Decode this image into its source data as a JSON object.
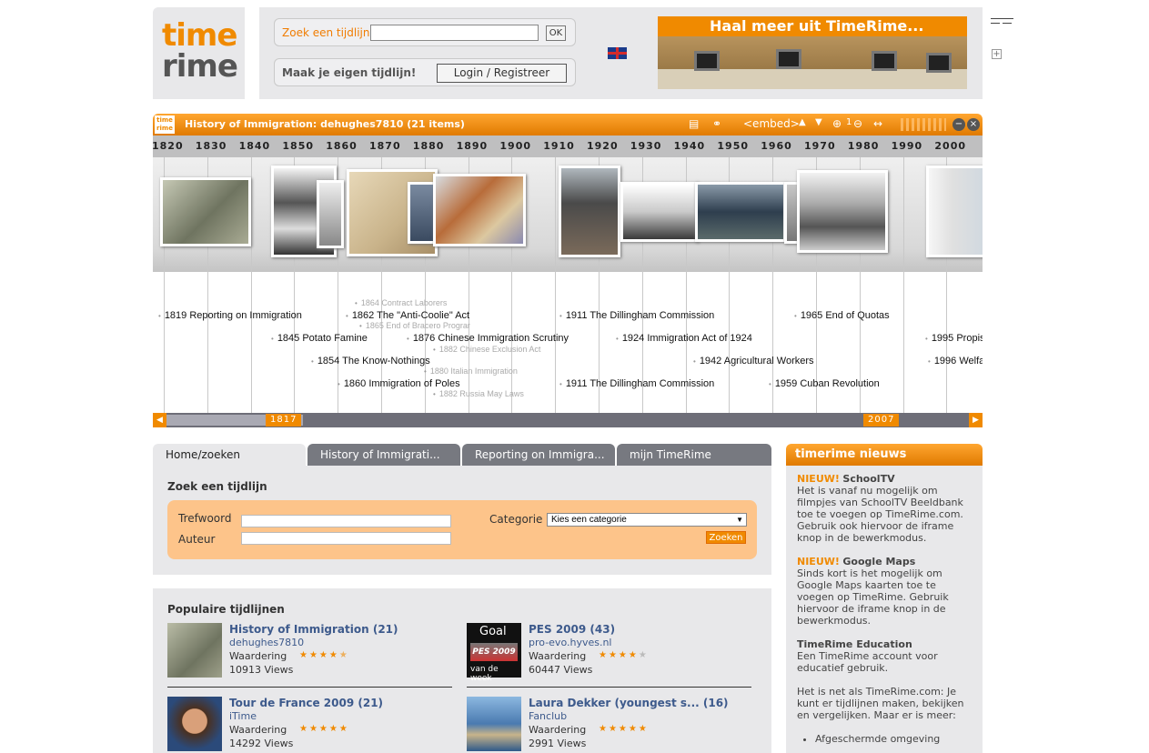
{
  "logo": {
    "line1": "time",
    "line2": "rime"
  },
  "header": {
    "search_label": "Zoek een tijdlijn",
    "search_value": "",
    "ok_label": "OK",
    "create_label": "Maak je eigen tijdlijn!",
    "login_label": "Login / Registreer",
    "banner_text": "Haal meer uit TimeRime..."
  },
  "timeline": {
    "logo_line1": "time",
    "logo_line2": "rime",
    "title": "History of Immigration: dehughes7810  (21 items)",
    "embed_label": "<embed>",
    "zoom_value": "1",
    "years": [
      "1820",
      "1830",
      "1840",
      "1850",
      "1860",
      "1870",
      "1880",
      "1890",
      "1900",
      "1910",
      "1920",
      "1930",
      "1940",
      "1950",
      "1960",
      "1970",
      "1980",
      "1990",
      "2000"
    ],
    "events": [
      {
        "label": "1864 Contract Laborers",
        "small": true
      },
      {
        "label": "1819 Reporting on Immigration",
        "small": false
      },
      {
        "label": "1862 The \"Anti-Coolie\" Act",
        "small": false
      },
      {
        "label": "1865 End of Bracero Prograr",
        "small": true
      },
      {
        "label": "1845 Potato Famine",
        "small": false
      },
      {
        "label": "1876 Chinese Immigration Scrutiny",
        "small": false
      },
      {
        "label": "1882 Chinese Exclusion Act",
        "small": true
      },
      {
        "label": "1854 The Know-Nothings",
        "small": false
      },
      {
        "label": "1880 Italian Immigration",
        "small": true
      },
      {
        "label": "1860 Immigration of Poles",
        "small": false
      },
      {
        "label": "1882 Russia May Laws",
        "small": true
      },
      {
        "label": "1911 The Dillingham Commission",
        "small": false
      },
      {
        "label": "1924 Immigration Act of 1924",
        "small": false
      },
      {
        "label": "1942 Agricultural Workers",
        "small": false
      },
      {
        "label": "1911 The Dillingham Commission",
        "small": false
      },
      {
        "label": "1965 End of Quotas",
        "small": false
      },
      {
        "label": "1959 Cuban Revolution",
        "small": false
      },
      {
        "label": "1995 Propis",
        "small": false
      },
      {
        "label": "1996 Welfa",
        "small": false
      }
    ],
    "range_start": "1817",
    "range_end": "2007"
  },
  "tabs": [
    {
      "label": "Home/zoeken",
      "active": true
    },
    {
      "label": "History of Immigrati...",
      "active": false
    },
    {
      "label": "Reporting on Immigra...",
      "active": false
    },
    {
      "label": "mijn TimeRime",
      "active": false
    }
  ],
  "search": {
    "heading": "Zoek een tijdlijn",
    "keyword_label": "Trefwoord",
    "author_label": "Auteur",
    "category_label": "Categorie",
    "category_selected": "Kies een categorie",
    "submit_label": "Zoeken"
  },
  "popular": {
    "heading": "Populaire tijdlijnen",
    "items": [
      {
        "title": "History of Immigration (21)",
        "author": "dehughes7810",
        "rating_label": "Waardering",
        "rating": 4.5,
        "views": "10913 Views"
      },
      {
        "title": "PES 2009 (43)",
        "author": "pro-evo.hyves.nl",
        "rating_label": "Waardering",
        "rating": 4,
        "views": "60447 Views",
        "pic_caption_top": "Goal",
        "pic_caption_mid": "PES 2009",
        "pic_caption_bottom": "van de week"
      },
      {
        "title": "Tour de France 2009 (21)",
        "author": "iTime",
        "rating_label": "Waardering",
        "rating": 5,
        "views": "14292 Views"
      },
      {
        "title": "Laura Dekker (youngest s... (16)",
        "author": "Fanclub",
        "rating_label": "Waardering",
        "rating": 5,
        "views": "2991 Views"
      }
    ]
  },
  "news": {
    "heading": "timerime nieuws",
    "items": [
      {
        "badge": "NIEUW!",
        "title": "SchoolTV",
        "body": "Het is vanaf nu mogelijk om filmpjes van SchoolTV Beeldbank toe te voegen op TimeRime.com. Gebruik ook hiervoor de iframe knop in de bewerkmodus."
      },
      {
        "badge": "NIEUW!",
        "title": "Google Maps",
        "body": "Sinds kort is het mogelijk om Google Maps kaarten toe te voegen op TimeRime. Gebruik hiervoor de iframe knop in de bewerkmodus."
      },
      {
        "badge": "",
        "title": "TimeRime Education",
        "body": "Een TimeRime account voor educatief gebruik."
      },
      {
        "badge": "",
        "title": "",
        "body": "Het is net als TimeRime.com: Je kunt er tijdlijnen maken, bekijken en vergelijken. Maar er is meer:"
      }
    ],
    "list": [
      "Afgeschermde omgeving"
    ]
  },
  "colors": {
    "accent": "#f08a00",
    "panel": "#e8e8ea",
    "tab_inactive": "#777980",
    "link": "#3d5a8c"
  }
}
